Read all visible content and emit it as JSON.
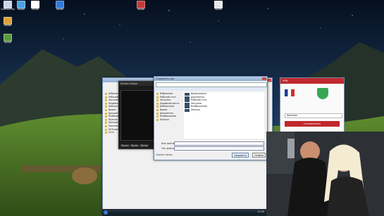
{
  "desktop_icons": [
    {
      "label": "Компьютер",
      "color": "#c9d6e6"
    },
    {
      "label": "Ярлык",
      "color": "#4ba3e3"
    },
    {
      "label": "Ярлык",
      "color": "#ffffff"
    },
    {
      "label": "Ярлык",
      "color": "#2f7bd6"
    },
    {
      "label": "Ярлык",
      "color": "#c33b3b"
    },
    {
      "label": "Ярлык",
      "color": "#e7e7e7"
    },
    {
      "label": "Ярлык",
      "color": "#d9a13a"
    },
    {
      "label": "Ярлык",
      "color": "#5b9a3e"
    }
  ],
  "windows": {
    "stream_app": {
      "title": "Stream Helper",
      "tabs": [
        "Ярлык",
        "Ярлык",
        "Ярлык",
        "Ярлык"
      ]
    },
    "save_dialog": {
      "title": "Сохранить как",
      "sidebar": [
        "Избранное",
        "Рабочий стол",
        "Загрузки",
        "Недавние места",
        "Библиотеки",
        "Видео",
        "Документы",
        "Изображения",
        "Музыка"
      ],
      "files": [
        "Видеозаписи",
        "Документы",
        "Рабочий стол",
        "Загрузки",
        "Изображения",
        "Музыка"
      ],
      "filename_label": "Имя файла:",
      "type_label": "Тип файла:",
      "save_label": "Сохранить",
      "cancel_label": "Отмена",
      "hide_folders": "Скрыть папки"
    },
    "explorer": {
      "sidebar": [
        "Избранное",
        "Рабочий стол",
        "Загрузки",
        "Недавние места",
        "Библиотеки",
        "Видео",
        "Документы",
        "Изображения",
        "Музыка",
        "Компьютер",
        "Локальный диск (C:)",
        "DVD-дисковод (E:)",
        "Сеть"
      ]
    }
  },
  "vpn": {
    "header": "VPN",
    "status_label": "Франция",
    "connect_label": "Отключиться",
    "accent": "#c0282d",
    "shield": "#3aa655"
  },
  "taskbar": {
    "time": "12:00"
  }
}
